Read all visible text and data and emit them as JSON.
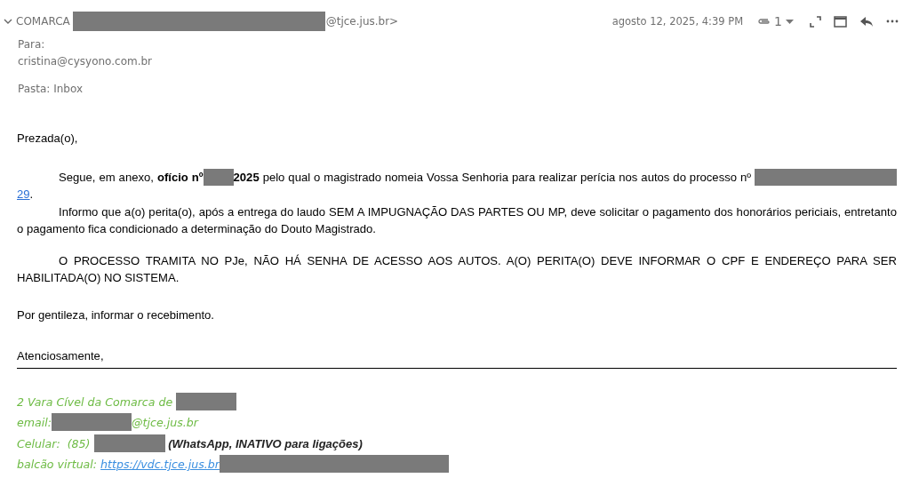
{
  "header": {
    "sender": [
      {
        "kind": "text",
        "text": "COMARCA"
      },
      {
        "kind": "redacted"
      },
      {
        "kind": "text",
        "text": "@tjce.jus.br>"
      }
    ],
    "date": "agosto 12, 2025, 4:39 PM",
    "attachment_count": "1"
  },
  "recipient": {
    "label": "Para:",
    "address": "cristina@cysyono.com.br"
  },
  "folder": "Pasta: Inbox",
  "body": [
    {
      "kind": "plain",
      "segments": [
        {
          "kind": "text",
          "text": "Prezada(o),"
        }
      ]
    },
    {
      "kind": "indented",
      "segments": [
        {
          "kind": "text",
          "text": "Segue, em anexo, "
        },
        {
          "kind": "bold",
          "text": "ofício nº"
        },
        {
          "kind": "redacted"
        },
        {
          "kind": "bold",
          "text": "2025"
        },
        {
          "kind": "text",
          "text": " pelo qual o magistrado nomeia Vossa Senhoria para realizar perícia nos autos do processo nº "
        },
        {
          "kind": "redacted"
        },
        {
          "kind": "redacted"
        },
        {
          "kind": "link",
          "text": "29"
        },
        {
          "kind": "text",
          "text": "."
        }
      ]
    },
    {
      "kind": "indented",
      "segments": [
        {
          "kind": "text",
          "text": "Informo que a(o) perita(o), após a entrega do laudo SEM A IMPUGNAÇÃO DAS PARTES OU MP, deve solicitar o pagamento dos honorários periciais, entretanto o pagamento fica condicionado a determinação do Douto Magistrado."
        }
      ]
    },
    {
      "kind": "indented",
      "segments": [
        {
          "kind": "text",
          "text": "O PROCESSO TRAMITA NO PJe, NÃO HÁ SENHA DE ACESSO AOS AUTOS. A(O) PERITA(O) DEVE INFORMAR O CPF E ENDEREÇO PARA SER HABILITADA(O) NO SISTEMA."
        }
      ]
    },
    {
      "kind": "plain",
      "segments": [
        {
          "kind": "text",
          "text": "Por gentileza, informar o recebimento."
        }
      ]
    },
    {
      "kind": "closing",
      "segments": [
        {
          "kind": "text",
          "text": "Atenciosamente,"
        }
      ]
    }
  ],
  "signature": [
    {
      "segments": [
        {
          "kind": "text",
          "text": "2 Vara Cível da Comarca de "
        },
        {
          "kind": "redacted"
        }
      ]
    },
    {
      "segments": [
        {
          "kind": "text",
          "text": "email:"
        },
        {
          "kind": "redacted"
        },
        {
          "kind": "text",
          "text": "@tjce.jus.br"
        }
      ]
    },
    {
      "segments": [
        {
          "kind": "text",
          "text": "Celular:  (85) "
        },
        {
          "kind": "redacted"
        },
        {
          "kind": "note",
          "text": " (WhatsApp, INATIVO para ligações)"
        }
      ]
    },
    {
      "segments": [
        {
          "kind": "text",
          "text": "balcão virtual: "
        },
        {
          "kind": "link",
          "text": "https://vdc.tjce.jus.br"
        },
        {
          "kind": "redacted"
        }
      ]
    }
  ]
}
